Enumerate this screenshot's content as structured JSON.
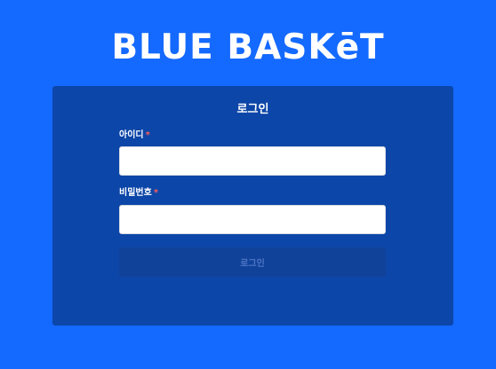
{
  "app": {
    "logo_text": "BLUE BASKēT"
  },
  "login_form": {
    "title": "로그인",
    "id_label": "아이디",
    "id_required_mark": "*",
    "id_value": "",
    "id_placeholder": "",
    "password_label": "비밀번호",
    "password_required_mark": "*",
    "password_value": "",
    "password_placeholder": "",
    "submit_label": "로그인",
    "submit_enabled": false
  },
  "colors": {
    "background": "#1469ff",
    "panel": "#0c46a8",
    "button_disabled": "#11429a",
    "button_text_disabled": "#4e76c4",
    "required_mark": "#ff5a5a"
  }
}
